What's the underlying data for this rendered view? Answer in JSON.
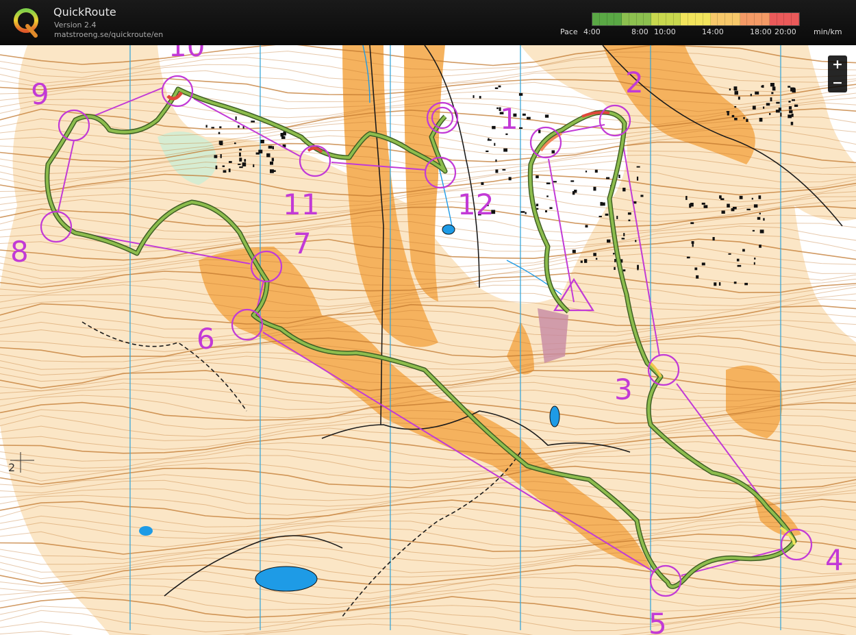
{
  "app": {
    "title": "QuickRoute",
    "version": "Version 2.4",
    "url": "matstroeng.se/quickroute/en",
    "logo_letter": "Q"
  },
  "pace_legend": {
    "label": "Pace",
    "ticks": [
      "4:00",
      "8:00",
      "10:00",
      "14:00",
      "18:00",
      "20:00"
    ],
    "unit": "min/km",
    "gradient_colors": [
      "#5aa845",
      "#8cc04f",
      "#c8d84e",
      "#f2e45c",
      "#f7c86a",
      "#f49a66",
      "#ea5a5a"
    ]
  },
  "zoom": {
    "in_label": "+",
    "out_label": "−"
  },
  "controls": [
    {
      "label": "1",
      "type": "control"
    },
    {
      "label": "2",
      "type": "control"
    },
    {
      "label": "3",
      "type": "control"
    },
    {
      "label": "4",
      "type": "control"
    },
    {
      "label": "5",
      "type": "control"
    },
    {
      "label": "6",
      "type": "control"
    },
    {
      "label": "7",
      "type": "control"
    },
    {
      "label": "8",
      "type": "control"
    },
    {
      "label": "9",
      "type": "control"
    },
    {
      "label": "10",
      "type": "control"
    },
    {
      "label": "11",
      "type": "control"
    },
    {
      "label": "12",
      "type": "control"
    }
  ],
  "map_marks": {
    "scale_marker": "2"
  },
  "colors": {
    "course": "#c23ad6",
    "route_slow": "#e0463a",
    "route_fast": "#7bb043",
    "terrain_open": "#f5b25e",
    "terrain_forest": "#fbe3c0",
    "water": "#1e9be6",
    "north_line": "#3aa7d8"
  }
}
